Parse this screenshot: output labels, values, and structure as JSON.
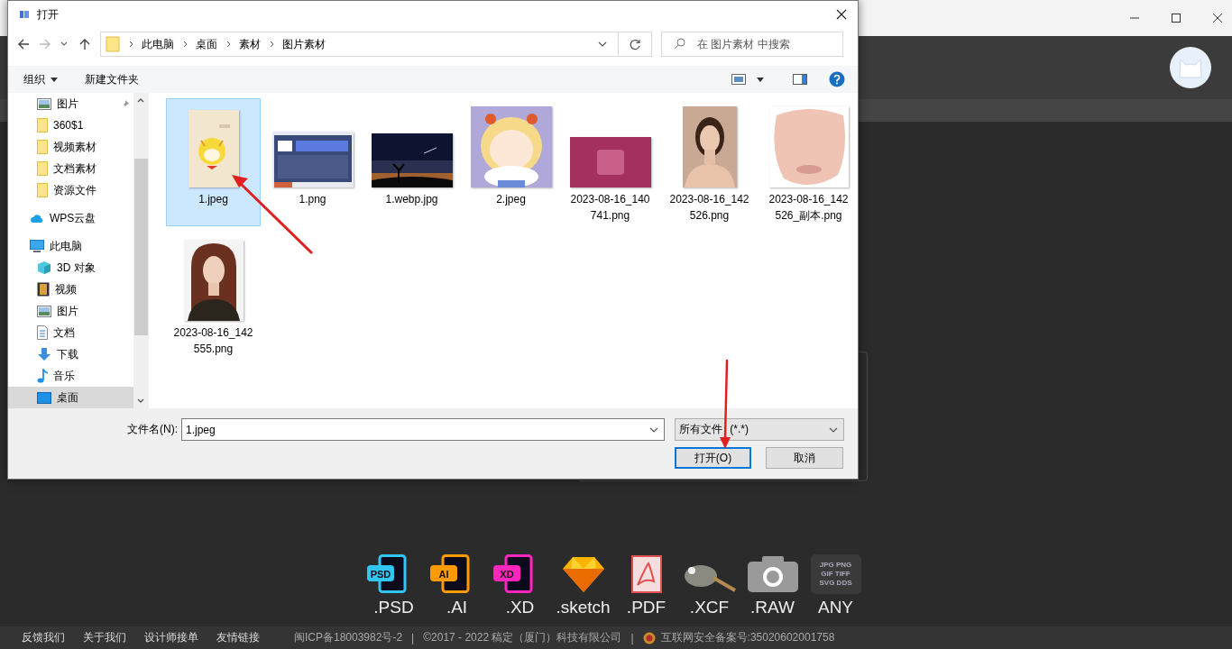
{
  "dialog": {
    "title": "打开",
    "breadcrumbs": [
      "此电脑",
      "桌面",
      "素材",
      "图片素材"
    ],
    "search_placeholder": "在 图片素材 中搜索",
    "toolbar": {
      "organize": "组织",
      "new_folder": "新建文件夹"
    },
    "quick_access": [
      {
        "label": "图片",
        "pinned": true,
        "selected": false
      },
      {
        "label": "360$1",
        "pinned": false,
        "selected": false
      },
      {
        "label": "视频素材",
        "pinned": false,
        "selected": false
      },
      {
        "label": "文档素材",
        "pinned": false,
        "selected": false
      },
      {
        "label": "资源文件",
        "pinned": false,
        "selected": false
      }
    ],
    "nav_roots": [
      {
        "label": "WPS云盘",
        "selected": false
      },
      {
        "label": "此电脑",
        "selected": false,
        "children": [
          {
            "label": "3D 对象",
            "selected": false
          },
          {
            "label": "视频",
            "selected": false
          },
          {
            "label": "图片",
            "selected": false
          },
          {
            "label": "文档",
            "selected": false
          },
          {
            "label": "下载",
            "selected": false
          },
          {
            "label": "音乐",
            "selected": false
          },
          {
            "label": "桌面",
            "selected": true
          }
        ]
      }
    ],
    "files": [
      {
        "name": "1.jpeg",
        "selected": true
      },
      {
        "name": "1.png",
        "selected": false
      },
      {
        "name": "1.webp.jpg",
        "selected": false
      },
      {
        "name": "2.jpeg",
        "selected": false
      },
      {
        "name": "2023-08-16_140741.png",
        "selected": false
      },
      {
        "name": "2023-08-16_142526.png",
        "selected": false
      },
      {
        "name": "2023-08-16_142526_副本.png",
        "selected": false
      },
      {
        "name": "2023-08-16_142555.png",
        "selected": false
      }
    ],
    "filename_label": "文件名(N):",
    "filename": "1.jpeg",
    "filter": "所有文件 (*.*)",
    "buttons": [
      {
        "label": "打开(O)",
        "kind": "primary"
      },
      {
        "label": "取消",
        "kind": "normal"
      }
    ]
  },
  "formats": [
    {
      "kind": "psd",
      "badge": "PSD",
      "label": ".PSD"
    },
    {
      "kind": "ai",
      "badge": "AI",
      "label": ".AI"
    },
    {
      "kind": "xd",
      "badge": "XD",
      "label": ".XD"
    },
    {
      "kind": "sketch",
      "label": ".sketch"
    },
    {
      "kind": "pdf",
      "label": ".PDF"
    },
    {
      "kind": "xcf",
      "label": ".XCF"
    },
    {
      "kind": "raw",
      "label": ".RAW"
    },
    {
      "kind": "any",
      "badge_lines": [
        "JPG PNG",
        "GIF TIFF",
        "SVG DDS"
      ],
      "label": "ANY"
    }
  ],
  "footer": [
    {
      "kind": "link",
      "text": "反馈我们"
    },
    {
      "kind": "link",
      "text": "关于我们"
    },
    {
      "kind": "link",
      "text": "设计师接单"
    },
    {
      "kind": "link",
      "text": "友情链接"
    },
    {
      "kind": "text",
      "text": "闽ICP备18003982号-2"
    },
    {
      "kind": "sep",
      "text": "|"
    },
    {
      "kind": "text",
      "text": "©2017 - 2022 稿定（厦门）科技有限公司"
    },
    {
      "kind": "sep",
      "text": "|"
    },
    {
      "kind": "badge",
      "text": "互联网安全备案号:35020602001758"
    }
  ]
}
